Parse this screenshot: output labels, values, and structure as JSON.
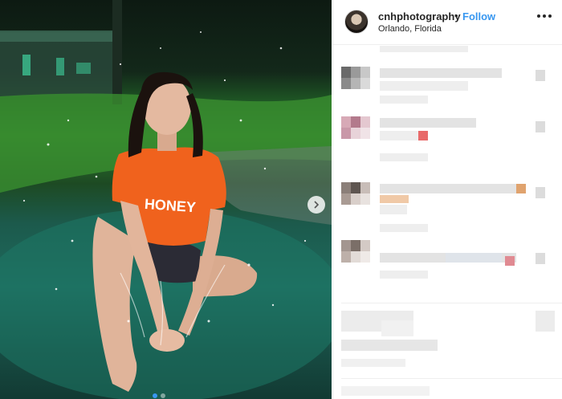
{
  "post": {
    "username": "cnhphotography",
    "separator": "•",
    "follow_label": "Follow",
    "location": "Orlando, Florida",
    "shirt_text": "HONEY"
  },
  "icons": {
    "next": "chevron-right-icon",
    "more": "more-options-icon",
    "avatar": "profile-avatar"
  },
  "colors": {
    "follow": "#3897f0",
    "username": "#262626",
    "border": "#efefef"
  }
}
